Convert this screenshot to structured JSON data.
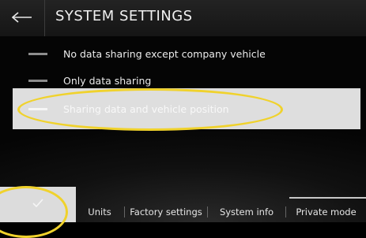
{
  "header": {
    "title": "SYSTEM SETTINGS",
    "back_icon": "left-arrow-icon"
  },
  "options": [
    {
      "label": "No data sharing except company vehicle",
      "selected": false
    },
    {
      "label": "Only data sharing",
      "selected": false
    },
    {
      "label": "Sharing data and vehicle position",
      "selected": true
    }
  ],
  "bottom_bar": {
    "confirm_icon": "checkmark-icon",
    "tabs": [
      {
        "label": "Units"
      },
      {
        "label": "Factory settings"
      },
      {
        "label": "System info"
      },
      {
        "label": "Private mode",
        "active": true
      }
    ]
  },
  "colors": {
    "highlight_ellipse": "#f0d22c",
    "selected_row": "#dedede"
  }
}
